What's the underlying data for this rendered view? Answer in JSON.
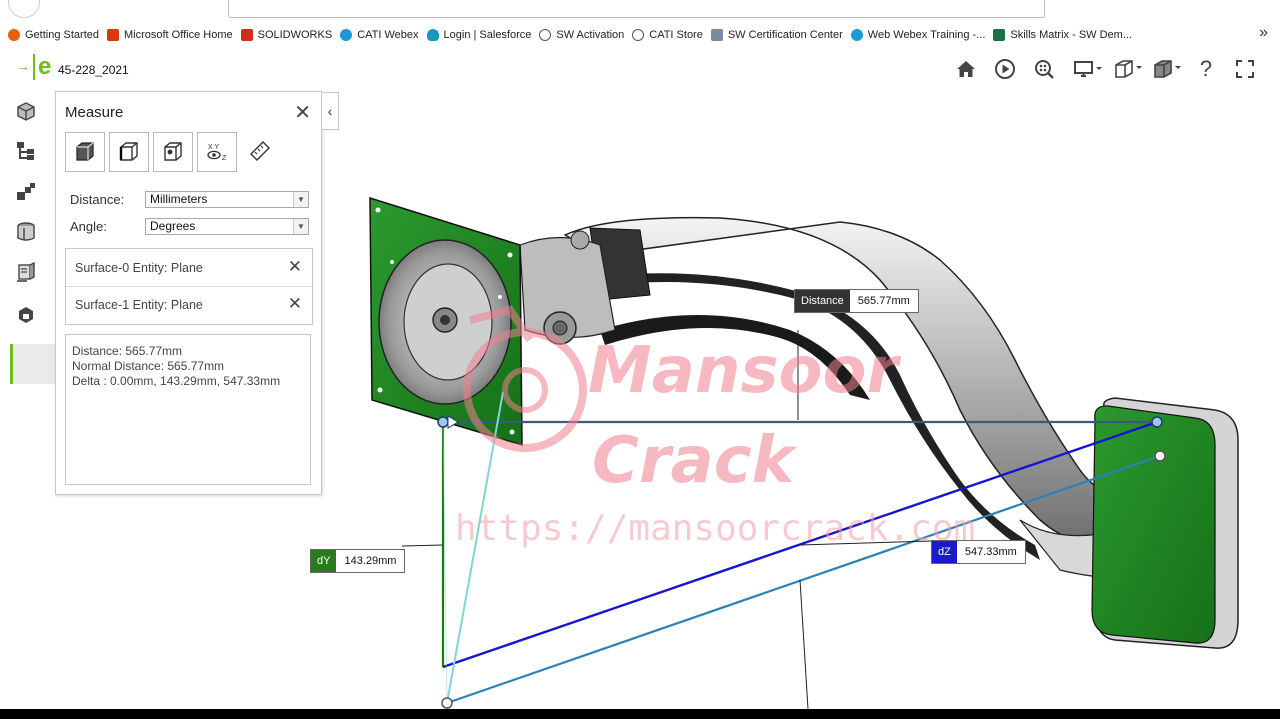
{
  "bookmarks": [
    {
      "label": "Getting Started",
      "color": "#e66000"
    },
    {
      "label": "Microsoft Office Home",
      "color": "#d83b01"
    },
    {
      "label": "SOLIDWORKS",
      "color": "#d52b1e"
    },
    {
      "label": "CATI Webex",
      "color": "#1a9bd7"
    },
    {
      "label": "Login | Salesforce",
      "color": "#1798c1"
    },
    {
      "label": "SW Activation",
      "color": "#555555"
    },
    {
      "label": "CATI Store",
      "color": "#555555"
    },
    {
      "label": "SW Certification Center",
      "color": "#7a8aa0"
    },
    {
      "label": "Web Webex Training -...",
      "color": "#1a9bd7"
    },
    {
      "label": "Skills Matrix - SW Dem...",
      "color": "#1d6f42"
    }
  ],
  "bookmarks_more": "»",
  "app": {
    "logo_arrow": "→",
    "logo_letter": "e",
    "doc_title": "45-228_2021"
  },
  "toolbar_icons": [
    "home-icon",
    "play-icon",
    "zoom-icon",
    "display-icon",
    "view-cube-icon",
    "render-mode-icon",
    "help-icon",
    "fullscreen-icon"
  ],
  "toolbar_glyphs": {
    "help": "?"
  },
  "measure": {
    "title": "Measure",
    "close": "✕",
    "collapse": "‹",
    "distance_label": "Distance:",
    "distance_unit": "Millimeters",
    "angle_label": "Angle:",
    "angle_unit": "Degrees",
    "entities": [
      {
        "label": "Surface-0 Entity: Plane"
      },
      {
        "label": "Surface-1 Entity: Plane"
      }
    ],
    "remove_glyph": "✕",
    "results": [
      "Distance: 565.77mm",
      "Normal Distance: 565.77mm",
      "Delta : 0.00mm, 143.29mm, 547.33mm"
    ]
  },
  "callouts": {
    "distance": {
      "key": "Distance",
      "value": "565.77mm",
      "color": "#333333"
    },
    "dy": {
      "key": "dY",
      "value": "143.29mm",
      "color": "#2a7a1e"
    },
    "dz": {
      "key": "dZ",
      "value": "547.33mm",
      "color": "#1a1acc"
    }
  },
  "watermark": {
    "line1": "Mansoor",
    "line2": "Crack",
    "url": "https://mansoorcrack.com"
  },
  "colors": {
    "accent": "#6bbf1a",
    "plate_green": "#1f8a22",
    "dx_line": "#2a6fb0",
    "dz_line": "#1515d0"
  }
}
